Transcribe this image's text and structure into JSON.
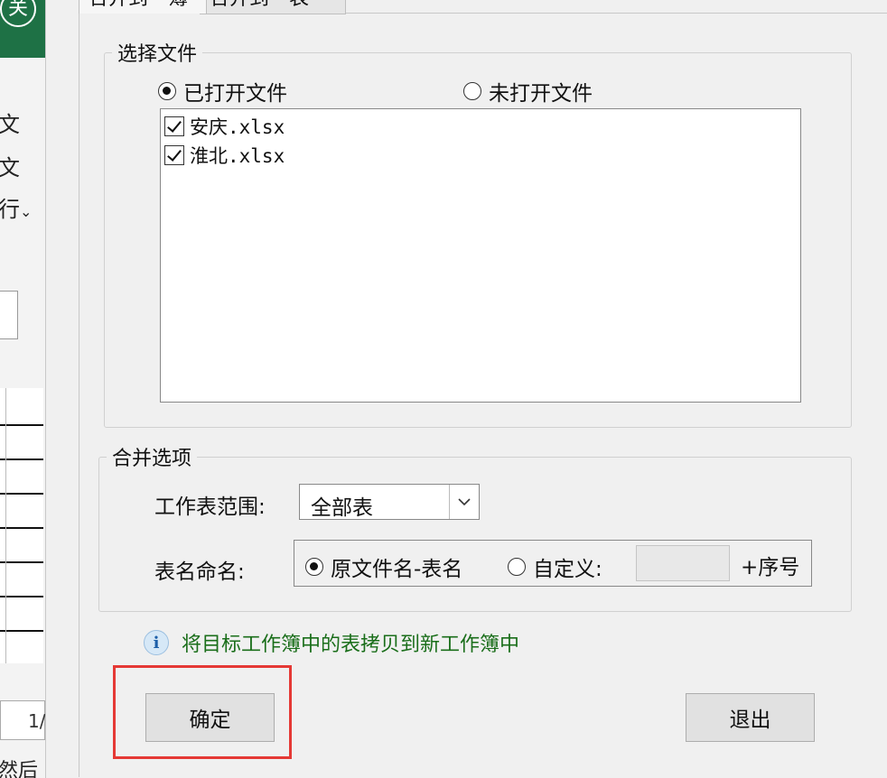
{
  "background_app": {
    "circle_char": "关",
    "side_texts": [
      "文",
      "文",
      "行"
    ],
    "chevron_char": "⌄",
    "page_fragment": "1/",
    "bottom_fragment": "然后按"
  },
  "tabs": {
    "active": "合并到一簿",
    "second": "合并到一表"
  },
  "select_files": {
    "legend": "选择文件",
    "radio_opened": "已打开文件",
    "radio_unopened": "未打开文件",
    "selected": "opened",
    "files": [
      {
        "name": "安庆.xlsx",
        "checked": true
      },
      {
        "name": "淮北.xlsx",
        "checked": true
      }
    ]
  },
  "merge_options": {
    "legend": "合并选项",
    "sheet_range_label": "工作表范围:",
    "sheet_range_value": "全部表",
    "naming_label": "表名命名:",
    "naming_radio_original": "原文件名-表名",
    "naming_radio_custom": "自定义:",
    "custom_value": "",
    "sequence_suffix": "+序号"
  },
  "info_text": "将目标工作簿中的表拷贝到新工作簿中",
  "buttons": {
    "ok": "确定",
    "exit": "退出"
  },
  "colors": {
    "highlight": "#e53935",
    "info_text": "#1a6e1a",
    "excel_green": "#1e7145"
  }
}
